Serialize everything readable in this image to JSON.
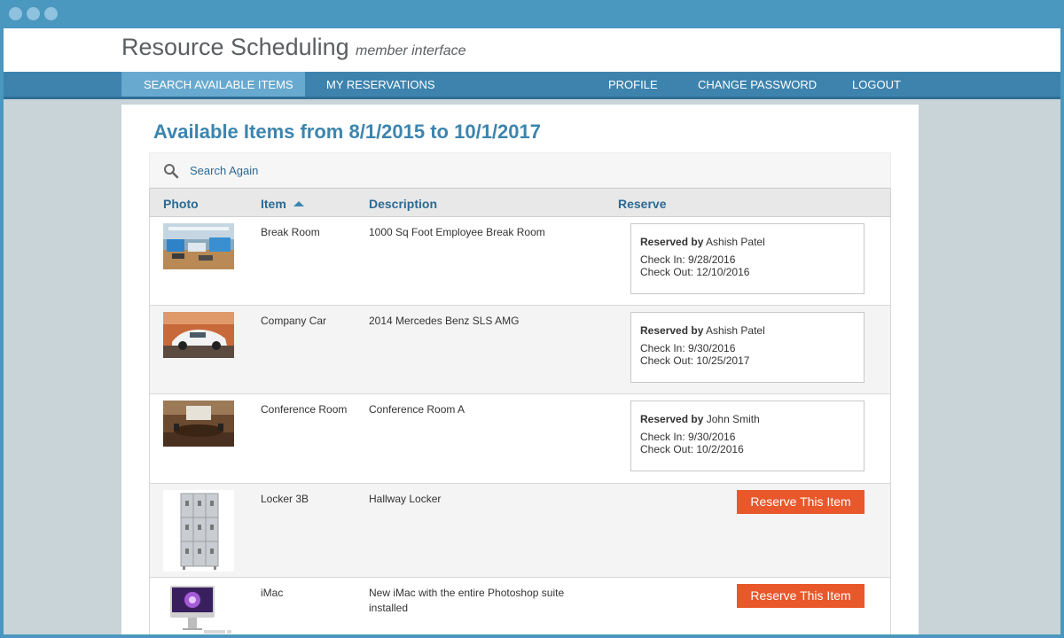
{
  "app": {
    "title": "Resource Scheduling",
    "subtitle": "member interface"
  },
  "nav": {
    "search": "SEARCH AVAILABLE ITEMS",
    "reservations": "MY RESERVATIONS",
    "profile": "PROFILE",
    "change_password": "CHANGE PASSWORD",
    "logout": "LOGOUT",
    "active": "SEARCH AVAILABLE ITEMS"
  },
  "page": {
    "title": "Available Items from 8/1/2015 to 10/1/2017",
    "search_again": "Search Again"
  },
  "table": {
    "headers": {
      "photo": "Photo",
      "item": "Item",
      "description": "Description",
      "reserve": "Reserve"
    },
    "sort": {
      "column": "Item",
      "direction": "ascending"
    },
    "rows": [
      {
        "item": "Break Room",
        "description": "1000 Sq Foot Employee Break Room",
        "reserved_by_label": "Reserved by",
        "reserved_by": "Ashish Patel",
        "check_in": "Check In: 9/28/2016",
        "check_out": "Check Out: 12/10/2016"
      },
      {
        "item": "Company Car",
        "description": "2014 Mercedes Benz SLS AMG",
        "reserved_by_label": "Reserved by",
        "reserved_by": "Ashish Patel",
        "check_in": "Check In: 9/30/2016",
        "check_out": "Check Out: 10/25/2017"
      },
      {
        "item": "Conference Room",
        "description": "Conference Room A",
        "reserved_by_label": "Reserved by",
        "reserved_by": "John Smith",
        "check_in": "Check In: 9/30/2016",
        "check_out": "Check Out: 10/2/2016"
      },
      {
        "item": "Locker 3B",
        "description": "Hallway Locker",
        "button": "Reserve This Item"
      },
      {
        "item": "iMac",
        "description": "New iMac with the entire Photoshop suite installed",
        "button": "Reserve This Item"
      }
    ]
  },
  "colors": {
    "accent": "#3c85ae",
    "nav": "#3d83ae",
    "nav_active": "#68a9cf",
    "button": "#e9582a",
    "frame": "#4a97bf"
  }
}
